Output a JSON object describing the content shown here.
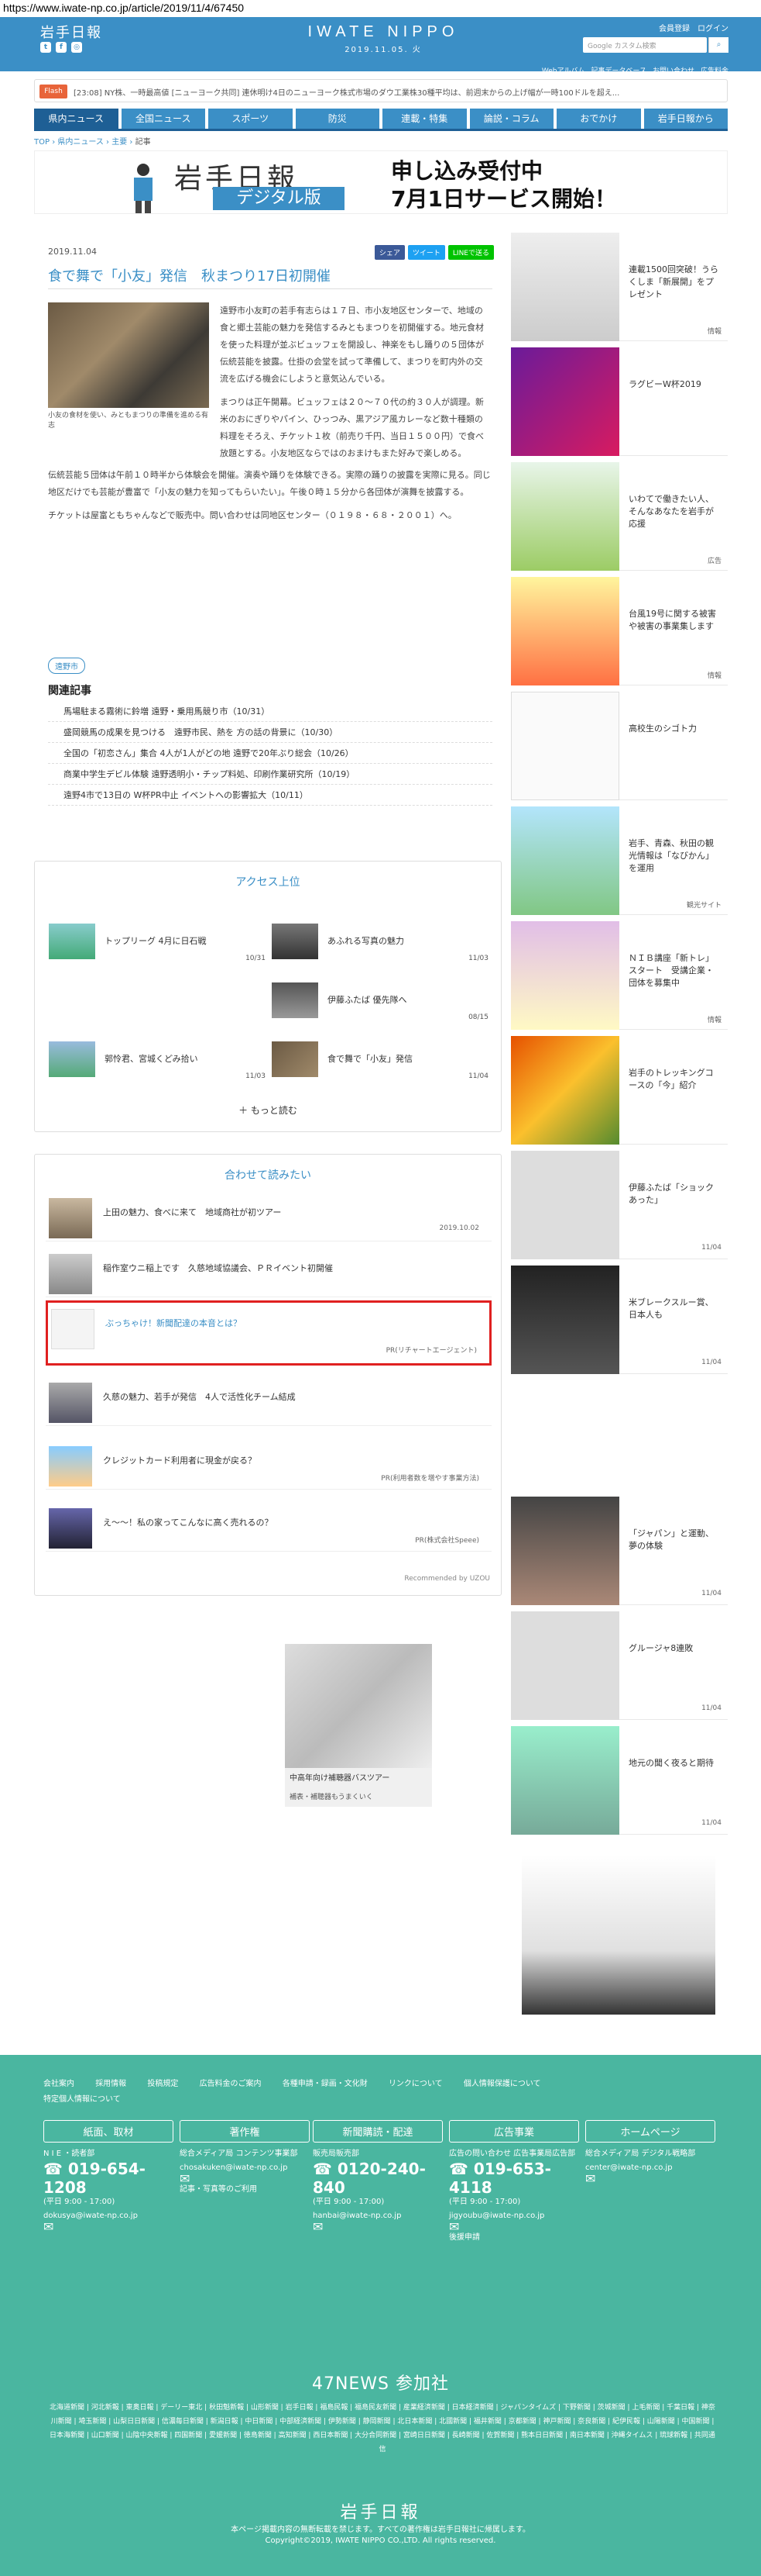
{
  "url": "https://www.iwate-np.co.jp/article/2019/11/4/67450",
  "header": {
    "logo": "岩手日報",
    "brand": "IWATE NIPPO",
    "date": "2019.11.05. 火",
    "links_top": [
      "会員登録",
      "ログイン"
    ],
    "search_placeholder": "Google カスタム検索",
    "links_bottom": [
      "Webアルバム",
      "記事データベース",
      "お問い合わせ",
      "広告料金"
    ]
  },
  "flash": {
    "label": "Flash",
    "text": "[23:08] NY株、一時最高値  [ニューヨーク共同] 連休明け4日のニューヨーク株式市場のダウ工業株30種平均は、前週末からの上げ幅が一時100ドルを超え..."
  },
  "nav": [
    "県内ニュース",
    "全国ニュース",
    "スポーツ",
    "防災",
    "連載・特集",
    "論説・コラム",
    "おでかけ",
    "岩手日報から"
  ],
  "breadcrumb": [
    "TOP",
    "県内ニュース",
    "主要",
    "記事"
  ],
  "banner": {
    "logo_line1": "岩手日報",
    "logo_line2": "デジタル版",
    "text1": "申し込み受付中",
    "text2": "7月1日サービス開始！"
  },
  "article": {
    "date": "2019.11.04",
    "share": [
      "シェア",
      "ツイート",
      "LINEで送る"
    ],
    "title": "食で舞で「小友」発信　秋まつり17日初開催",
    "caption": "小友の食材を使い、みともまつりの準備を進める有志",
    "para1": "遠野市小友町の若手有志らは１７日、市小友地区センターで、地域の食と郷土芸能の魅力を発信するみともまつりを初開催する。地元食材を使った料理が並ぶビュッフェを開設し、神楽をもし踊りの５団体が伝統芸能を披露。仕掛の会堂を試って準備して、まつりを町内外の交流を広げる機会にしようと意気込んでいる。",
    "para2": "まつりは正午開幕。ビュッフェは２０〜７０代の約３０人が調理。新米のおにぎりやパイン、ひっつみ、黒アジア風カレーなど数十種類の料理をそろえ、チケット１枚（前売り千円、当日１５００円）で食べ放題とする。小友地区ならではのおまけもまた好みで楽しめる。",
    "para3": "伝統芸能５団体は午前１０時半から体験会を開催。演奏や踊りを体験できる。実際の踊りの披露を実際に見る。同じ地区だけでも芸能が豊富で「小友の魅力を知ってもらいたい」。午後０時１５分から各団体が演舞を披露する。",
    "para4": "チケットは屋富ともちゃんなどで販売中。問い合わせは同地区センター（０１９８・６８・２００１）へ。",
    "tag": "遠野市",
    "related_title": "関連記事",
    "related": [
      "馬場駐まる霧術に鈴増 遠野・乗用馬競り市（10/31）",
      "盛岡競馬の成果を見つける　遠野市民、熱を 方の話の背景に（10/30）",
      "全国の「初恋さん」集合 4人が1人がどの地 遠野で20年ぶり総会（10/26）",
      "商業中学生デビル体験 遠野透明小・チップ料処、印刷作業研究所（10/19）",
      "遠野4市で13日の W杯PR中止 イベントへの影響拡大（10/11）"
    ]
  },
  "ranking": {
    "title": "アクセス上位",
    "items": [
      {
        "text": "トップリーグ 4月に日石戦",
        "date": "10/31"
      },
      {
        "text": "あふれる写真の魅力",
        "date": "11/03"
      },
      {
        "text": "伊藤ふたば 優先隊へ",
        "date": "08/15"
      },
      {
        "text": "郭怜君、宮城くどみ拾い",
        "date": "11/03"
      },
      {
        "text": "食で舞で「小友」発信",
        "date": "11/04"
      }
    ],
    "more": "もっと読む"
  },
  "read_too": {
    "title": "合わせて読みたい",
    "items": [
      {
        "text": "上田の魅力、食べに来て　地域商社が初ツアー",
        "meta": "2019.10.02"
      },
      {
        "text": "稲作室ウニ稲上です　久慈地域協議会、ＰＲイベント初開催",
        "meta": ""
      },
      {
        "text": "ぶっちゃけ！新聞配達の本音とは？",
        "meta": "PR(リチャートエージェント)"
      },
      {
        "text": "久慈の魅力、若手が発信　4人で活性化チーム結成",
        "meta": ""
      },
      {
        "text": "クレジットカード利用者に現金が戻る？",
        "meta": "PR(利用者数を増やす事業方法)"
      },
      {
        "text": "え〜〜！私の家ってこんなに高く売れるの？",
        "meta": "PR(株式会社Speee)"
      }
    ],
    "recommended": "Recommended by UZOU"
  },
  "ad": {
    "caption": "中高年向け補聴器バスツアー",
    "sub": "補表・補聴器もうまくいく"
  },
  "sidebar": [
    {
      "text": "連載1500回突破！うらくしま「新展開」をプレゼント",
      "meta": "情報"
    },
    {
      "text": "ラグビーW杯2019",
      "meta": ""
    },
    {
      "text": "いわてで働きたい人、そんなあなたを岩手が応援",
      "meta": "広告"
    },
    {
      "text": "台風19号に関する被害や被害の事業集します",
      "meta": "情報"
    },
    {
      "text": "高校生のシゴト力",
      "meta": ""
    },
    {
      "text": "岩手、青森、秋田の観光情報は「なびかん」を運用",
      "meta": "観光サイト"
    },
    {
      "text": "ＮＩＢ講座「新トレ」スタート　受講企業・団体を募集中",
      "meta": "情報"
    },
    {
      "text": "岩手のトレッキングコースの「今」紹介",
      "meta": ""
    },
    {
      "text": "伊藤ふたば「ショックあった」",
      "meta": "11/04"
    },
    {
      "text": "米ブレークスルー賞、日本人も",
      "meta": "11/04"
    },
    {
      "text": "「ジャパン」と運動、夢の体験",
      "meta": "11/04"
    },
    {
      "text": "グルージャ8連敗",
      "meta": "11/04"
    },
    {
      "text": "地元の聞く夜ると期待",
      "meta": "11/04"
    }
  ],
  "footer": {
    "links": [
      "会社案内",
      "採用情報",
      "投稿規定",
      "広告料金のご案内",
      "各種申請・録画・文化財",
      "リンクについて",
      "個人情報保護について",
      "特定個人情報について"
    ],
    "cols": [
      {
        "head": "紙面、取材",
        "sub": "N I E ・読者部",
        "phone": "019-654-1208",
        "hours": "(平日 9:00 - 17:00)",
        "email": "dokusya@iwate-np.co.jp"
      },
      {
        "head": "著作権",
        "sub": "総合メディア局 コンテンツ事業部",
        "phone": "",
        "hours": "",
        "email": "chosakuken@iwate-np.co.jp",
        "link": "記事・写真等のご利用"
      },
      {
        "head": "新聞購読・配達",
        "sub": "販売局販売部",
        "phone": "0120-240-840",
        "hours": "(平日 9:00 - 17:00)",
        "email": "hanbai@iwate-np.co.jp"
      },
      {
        "head": "広告事業",
        "sub": "広告の問い合わせ 広告事業局広告部",
        "phone": "019-653-4118",
        "hours": "(平日 9:00 - 17:00)",
        "email": "jigyoubu@iwate-np.co.jp",
        "link": "後援申請"
      },
      {
        "head": "ホームページ",
        "sub": "総合メディア局 デジタル戦略部",
        "phone": "",
        "hours": "",
        "email": "center@iwate-np.co.jp"
      }
    ],
    "title47": "47NEWS 参加社",
    "papers": "北海道新聞 | 河北新報 | 東奥日報 | デーリー東北 | 秋田魁新報 | 山形新聞 | 岩手日報 | 福島民報 | 福島民友新聞 | 産業経済新聞 | 日本経済新聞 | ジャパンタイムズ | 下野新聞 | 茨城新聞 | 上毛新聞 | 千葉日報 | 神奈川新聞 | 埼玉新聞 | 山梨日日新聞 | 信濃毎日新聞 | 新潟日報 | 中日新聞 | 中部経済新聞 | 伊勢新聞 | 静岡新聞 | 北日本新聞 | 北國新聞 | 福井新聞 | 京都新聞 | 神戸新聞 | 奈良新聞 | 紀伊民報 | 山陽新聞 | 中国新聞 | 日本海新聞 | 山口新聞 | 山陰中央新報 | 四国新聞 | 愛媛新聞 | 徳島新聞 | 高知新聞 | 西日本新聞 | 大分合同新聞 | 宮崎日日新聞 | 長崎新聞 | 佐賀新聞 | 熊本日日新聞 | 南日本新聞 | 沖縄タイムス | 琉球新報 | 共同通信",
    "logo": "岩手日報",
    "notice": "本ページ掲載内容の無断転載を禁じます。すべての著作権は岩手日報社に帰属します。",
    "copyright": "Copyright©2019, IWATE NIPPO CO.,LTD. All rights reserved."
  }
}
